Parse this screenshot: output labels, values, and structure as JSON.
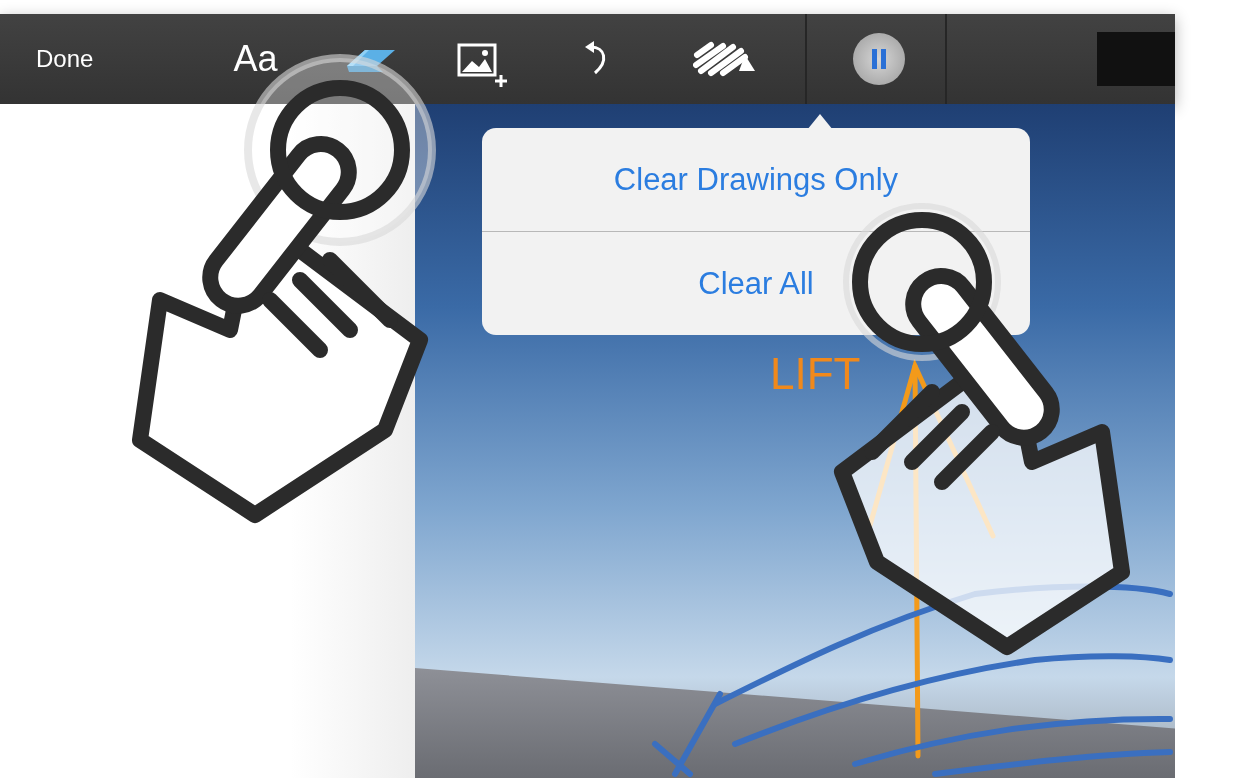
{
  "toolbar": {
    "done": "Done",
    "text_tool": "Aa"
  },
  "popover": {
    "items": [
      "Clear Drawings Only",
      "Clear All"
    ]
  },
  "canvas": {
    "annotation": "LIFT"
  }
}
